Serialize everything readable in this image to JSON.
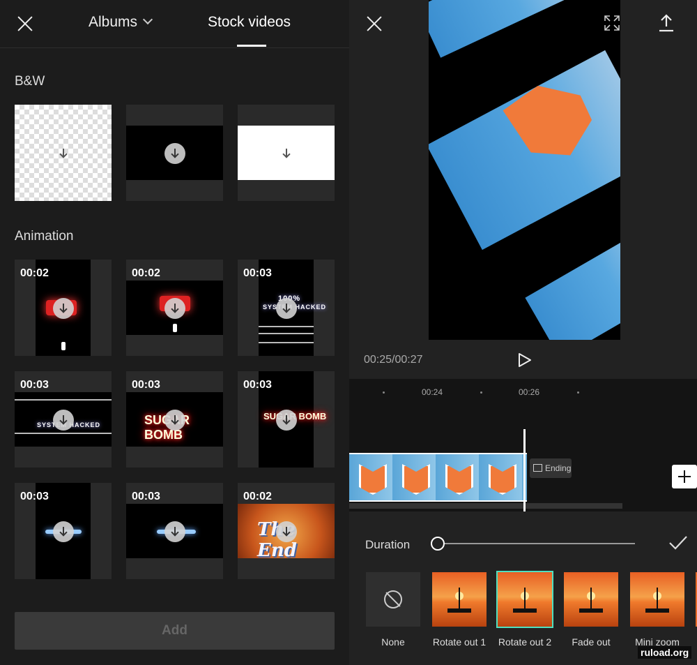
{
  "left": {
    "albums_label": "Albums",
    "stock_label": "Stock videos",
    "bw_title": "B&W",
    "animation_title": "Animation",
    "add_label": "Add",
    "animation_items": [
      {
        "duration": "00:02"
      },
      {
        "duration": "00:02"
      },
      {
        "duration": "00:03"
      },
      {
        "duration": "00:03"
      },
      {
        "duration": "00:03"
      },
      {
        "duration": "00:03"
      },
      {
        "duration": "00:03"
      },
      {
        "duration": "00:03"
      },
      {
        "duration": "00:02"
      }
    ],
    "overlay_text": {
      "percent": "100%",
      "system_hacked": "SYSTEM HACKED",
      "sugar_bomb": "SUGAR BOMB",
      "the_end": "The End"
    }
  },
  "right": {
    "time_readout": "00:25/00:27",
    "ticks": [
      "00:24",
      "00:26"
    ],
    "ending_label": "Ending",
    "duration_label": "Duration",
    "duration_value": 0.0,
    "animations": [
      {
        "label": "None"
      },
      {
        "label": "Rotate out 1"
      },
      {
        "label": "Rotate out 2",
        "selected": true
      },
      {
        "label": "Fade out"
      },
      {
        "label": "Mini zoom"
      }
    ]
  },
  "watermark": "ruload.org",
  "colors": {
    "accent_select": "#4fe0c0",
    "background": "#1c1c1c"
  }
}
